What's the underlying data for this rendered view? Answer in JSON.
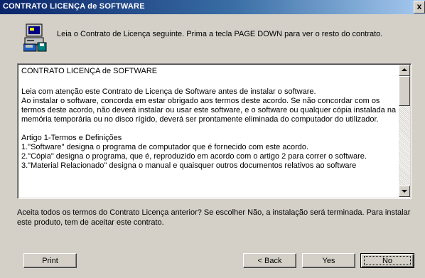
{
  "window": {
    "title": "CONTRATO LICENÇA de SOFTWARE",
    "close_glyph": "x"
  },
  "intro": "Leia o Contrato de Licença seguinte. Prima a tecla PAGE DOWN para ver o resto do contrato.",
  "license": {
    "heading": "CONTRATO  LICENÇA de SOFTWARE",
    "para1": " Leia com atenção este Contrato de Licença de Software antes de instalar o software.",
    "para2": "Ao instalar o software, concorda em estar obrigado aos termos deste acordo. Se não concordar com os termos deste acordo, não deverá instalar ou usar este software, e o software ou qualquer cópia instalada na memória temporária ou no disco rígido, deverá ser prontamente eliminada do computador do utilizador.",
    "article_heading": "Artigo 1-Termos e Definições",
    "item1": "1.\"Software\" designa o programa de computador que é fornecido com este acordo.",
    "item2": "2.\"Cópia\" designa o programa, que é, reproduzido em acordo com o artigo 2 para correr o software.",
    "item3": "3.\"Material Relacionado\" designa o manual e quaisquer outros documentos relativos ao software"
  },
  "question": "Aceita todos os termos do Contrato Licença anterior? Se escolher Não, a instalação será terminada. Para instalar este produto, tem de aceitar este contrato.",
  "buttons": {
    "print": "Print",
    "back": "< Back",
    "yes": "Yes",
    "no": "No"
  },
  "icons": {
    "setup": "setup-computer-icon"
  }
}
